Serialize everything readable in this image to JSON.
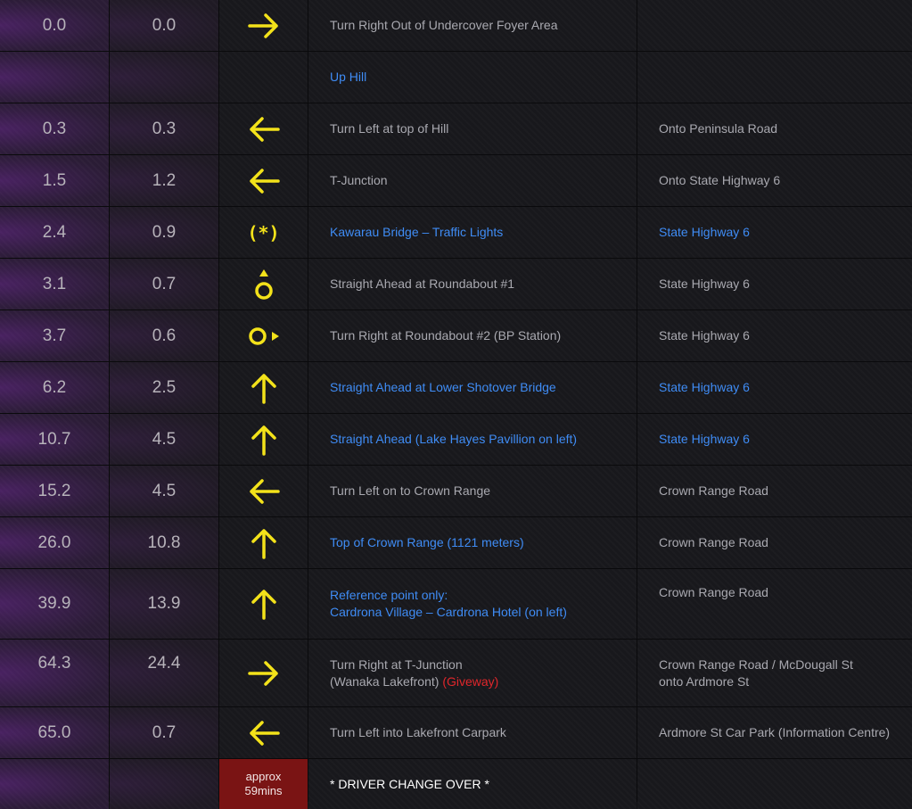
{
  "colors": {
    "arrow": "#f3e21a",
    "highlight_text": "#3f8cf5",
    "warning_text": "#e0262b",
    "approx_bg": "#7a1414"
  },
  "rows": [
    {
      "total": "0.0",
      "leg": "0.0",
      "icon": "arrow-right-icon",
      "instruction": "Turn Right Out of Undercover Foyer Area",
      "road": ""
    },
    {
      "total": "",
      "leg": "",
      "icon": "",
      "instruction": "Up Hill",
      "road": ""
    },
    {
      "total": "0.3",
      "leg": "0.3",
      "icon": "arrow-left-icon",
      "instruction": "Turn Left at top of Hill",
      "road": "Onto Peninsula Road"
    },
    {
      "total": "1.5",
      "leg": "1.2",
      "icon": "arrow-left-icon",
      "instruction": "T-Junction",
      "road": "Onto State Highway 6"
    },
    {
      "total": "2.4",
      "leg": "0.9",
      "icon": "traffic-lights-icon",
      "icon_text": "(*)",
      "instruction": "Kawarau Bridge – Traffic Lights",
      "road": "State Highway 6"
    },
    {
      "total": "3.1",
      "leg": "0.7",
      "icon": "roundabout-straight-icon",
      "instruction": "Straight Ahead at Roundabout #1",
      "road": "State Highway 6"
    },
    {
      "total": "3.7",
      "leg": "0.6",
      "icon": "roundabout-right-icon",
      "instruction": "Turn Right at Roundabout #2 (BP Station)",
      "road": "State Highway 6"
    },
    {
      "total": "6.2",
      "leg": "2.5",
      "icon": "arrow-up-icon",
      "instruction": "Straight Ahead at Lower Shotover Bridge",
      "road": "State Highway 6"
    },
    {
      "total": "10.7",
      "leg": "4.5",
      "icon": "arrow-up-icon",
      "instruction": "Straight Ahead (Lake Hayes Pavillion on left)",
      "road": "State Highway 6"
    },
    {
      "total": "15.2",
      "leg": "4.5",
      "icon": "arrow-left-icon",
      "instruction": "Turn Left on to Crown Range",
      "road": "Crown Range Road"
    },
    {
      "total": "26.0",
      "leg": "10.8",
      "icon": "arrow-up-icon",
      "instruction": "Top of Crown Range (1121 meters)",
      "road": "Crown Range Road"
    },
    {
      "total": "39.9",
      "leg": "13.9",
      "icon": "arrow-up-icon",
      "instruction_line1": "Reference point only:",
      "instruction_line2": "Cardrona Village – Cardrona Hotel (on left)",
      "road": "Crown Range Road"
    },
    {
      "total": "64.3",
      "leg": "24.4",
      "icon": "arrow-right-icon",
      "instruction_line1": "Turn Right at T-Junction",
      "instruction_line2": "(Wanaka Lakefront) ",
      "instruction_warning": "(Giveway)",
      "road_line1": "Crown Range Road / McDougall St",
      "road_line2": "onto Ardmore St"
    },
    {
      "total": "65.0",
      "leg": "0.7",
      "icon": "arrow-left-icon",
      "instruction": "Turn Left into Lakefront Carpark",
      "road": "Ardmore St Car Park (Information Centre)"
    },
    {
      "total": "",
      "leg": "",
      "approx_line1": "approx",
      "approx_line2": "59mins",
      "instruction": "* DRIVER CHANGE OVER *",
      "road": ""
    }
  ]
}
